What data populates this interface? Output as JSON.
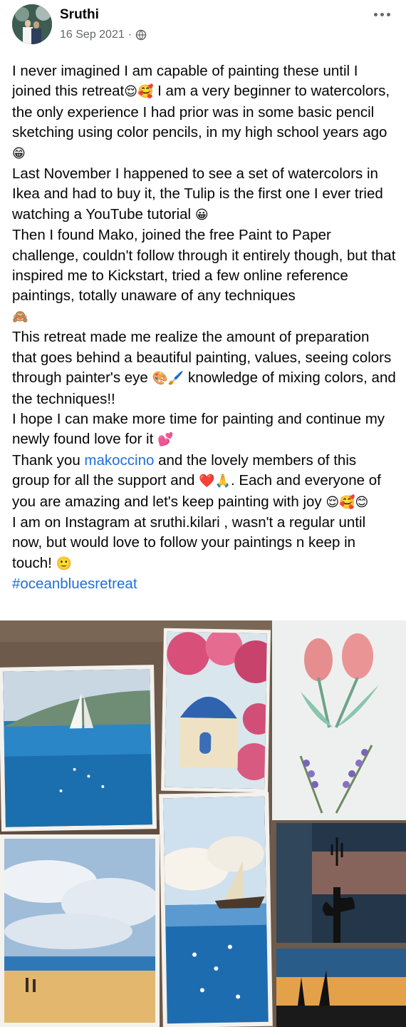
{
  "post": {
    "author": "Sruthi",
    "date": "16 Sep 2021",
    "separator": "·",
    "audience_icon": "globe-icon",
    "more_icon": "more-options-icon"
  },
  "body": {
    "p1_a": "I never imagined I am capable of painting these until I joined this retreat",
    "p1_emoji": "😌🥰",
    "p1_b": " I am a very beginner to watercolors, the only experience I had prior was in some basic pencil sketching using color pencils, in my high school years ago ",
    "p1_emoji2": "😁",
    "p2": "Last November I happened to see a set of watercolors in Ikea and had to buy it, the Tulip is the first one I ever tried watching a YouTube tutorial ",
    "p2_emoji": "😀",
    "p3": "Then I found Mako, joined the free Paint to Paper challenge, couldn't follow through it entirely though, but that inspired me to Kickstart, tried a few online reference paintings, totally unaware of any techniques",
    "p3_emoji": "🙈",
    "p4": "This retreat made me realize the amount of preparation that goes behind a beautiful painting, values, seeing colors through painter's eye ",
    "p4_emoji": "🎨🖌️",
    "p4_b": " knowledge of mixing colors, and the techniques!!",
    "p5": "I hope I can make more time for painting and continue my newly found love for it ",
    "p5_emoji": "💕",
    "p6_a": "Thank you ",
    "p6_link": "makoccino",
    "p6_b": " and the lovely members of this group for all the support and ",
    "p6_emoji": "❤️🙏",
    "p6_c": ". Each and everyone of you are amazing and let's keep painting with joy ",
    "p6_emoji2": "😌🥰😊",
    "p7": "I am on Instagram at sruthi.kilari , wasn't a regular until now, but would love to follow your paintings n keep in touch! ",
    "p7_emoji": "🙂",
    "hashtag": "#oceanbluesretreat"
  },
  "gallery": {
    "photos": [
      {
        "name": "sailboat-sea-painting"
      },
      {
        "name": "blue-dome-bougainvillea-painting"
      },
      {
        "name": "tulip-lavender-painting"
      },
      {
        "name": "cloudy-beach-painting"
      },
      {
        "name": "sailboat-sparkle-sea-painting"
      },
      {
        "name": "cactus-silhouette-painting"
      },
      {
        "name": "sunset-silhouette-painting"
      }
    ]
  }
}
